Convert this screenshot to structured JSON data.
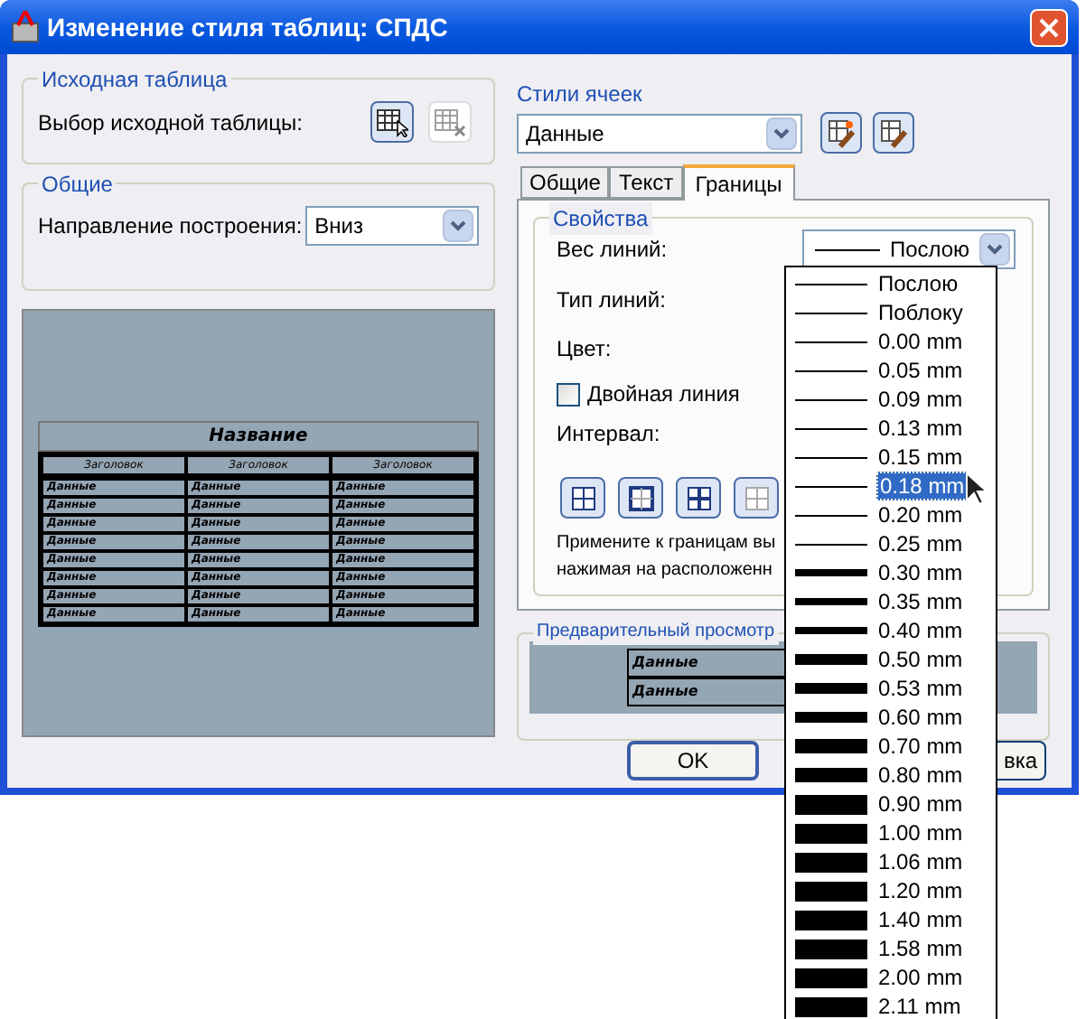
{
  "window": {
    "title": "Изменение стиля таблиц: СПДС"
  },
  "source_table": {
    "title": "Исходная таблица",
    "label": "Выбор исходной таблицы:"
  },
  "general": {
    "title": "Общие",
    "label": "Направление построения:",
    "value": "Вниз"
  },
  "preview_table": {
    "title": "Название",
    "headers": [
      "Заголовок",
      "Заголовок",
      "Заголовок"
    ],
    "rows": [
      [
        "Данные",
        "Данные",
        "Данные"
      ],
      [
        "Данные",
        "Данные",
        "Данные"
      ],
      [
        "Данные",
        "Данные",
        "Данные"
      ],
      [
        "Данные",
        "Данные",
        "Данные"
      ],
      [
        "Данные",
        "Данные",
        "Данные"
      ],
      [
        "Данные",
        "Данные",
        "Данные"
      ],
      [
        "Данные",
        "Данные",
        "Данные"
      ],
      [
        "Данные",
        "Данные",
        "Данные"
      ]
    ]
  },
  "cell_styles": {
    "title": "Стили ячеек",
    "value": "Данные"
  },
  "tabs": [
    {
      "label": "Общие",
      "selected": false
    },
    {
      "label": "Текст",
      "selected": false
    },
    {
      "label": "Границы",
      "selected": true
    }
  ],
  "properties": {
    "title": "Свойства",
    "lineweight_label": "Вес линий:",
    "lineweight_value": "Послою",
    "linetype_label": "Тип линий:",
    "color_label": "Цвет:",
    "double_line": {
      "label": "Двойная линия",
      "checked": false
    },
    "spacing_label": "Интервал:",
    "hint_lines": [
      "Примените к границам вы",
      "нажимая на расположенн"
    ]
  },
  "cell_preview": {
    "title": "Предварительный просмотр",
    "cells": [
      "Данные",
      "Данные"
    ]
  },
  "buttons": [
    {
      "label": "OK",
      "kind": "default"
    },
    {
      "label": "вка",
      "kind": "normal"
    }
  ],
  "lineweight_list": [
    {
      "label": "Послою",
      "kind": "thin",
      "selected": false
    },
    {
      "label": "Поблоку",
      "kind": "thin",
      "selected": false
    },
    {
      "label": "0.00 mm",
      "kind": "thin",
      "selected": false
    },
    {
      "label": "0.05 mm",
      "kind": "thin",
      "selected": false
    },
    {
      "label": "0.09 mm",
      "kind": "thin",
      "selected": false
    },
    {
      "label": "0.13 mm",
      "kind": "thin",
      "selected": false
    },
    {
      "label": "0.15 mm",
      "kind": "thin",
      "selected": false
    },
    {
      "label": "0.18 mm",
      "kind": "thin",
      "selected": true
    },
    {
      "label": "0.20 mm",
      "kind": "thin",
      "selected": false
    },
    {
      "label": "0.25 mm",
      "kind": "thin",
      "selected": false
    },
    {
      "label": "0.30 mm",
      "kind": "medium",
      "selected": false
    },
    {
      "label": "0.35 mm",
      "kind": "medium",
      "selected": false
    },
    {
      "label": "0.40 mm",
      "kind": "medium",
      "selected": false
    },
    {
      "label": "0.50 mm",
      "kind": "bold",
      "selected": false
    },
    {
      "label": "0.53 mm",
      "kind": "bold",
      "selected": false
    },
    {
      "label": "0.60 mm",
      "kind": "bold",
      "selected": false
    },
    {
      "label": "0.70 mm",
      "kind": "heavy",
      "selected": false
    },
    {
      "label": "0.80 mm",
      "kind": "heavy",
      "selected": false
    },
    {
      "label": "0.90 mm",
      "kind": "heaviest",
      "selected": false
    },
    {
      "label": "1.00 mm",
      "kind": "heaviest",
      "selected": false
    },
    {
      "label": "1.06 mm",
      "kind": "heaviest",
      "selected": false
    },
    {
      "label": "1.20 mm",
      "kind": "heaviest",
      "selected": false
    },
    {
      "label": "1.40 mm",
      "kind": "heaviest",
      "selected": false
    },
    {
      "label": "1.58 mm",
      "kind": "heaviest",
      "selected": false
    },
    {
      "label": "2.00 mm",
      "kind": "heaviest",
      "selected": false
    },
    {
      "label": "2.11 mm",
      "kind": "heaviest",
      "selected": false
    }
  ]
}
